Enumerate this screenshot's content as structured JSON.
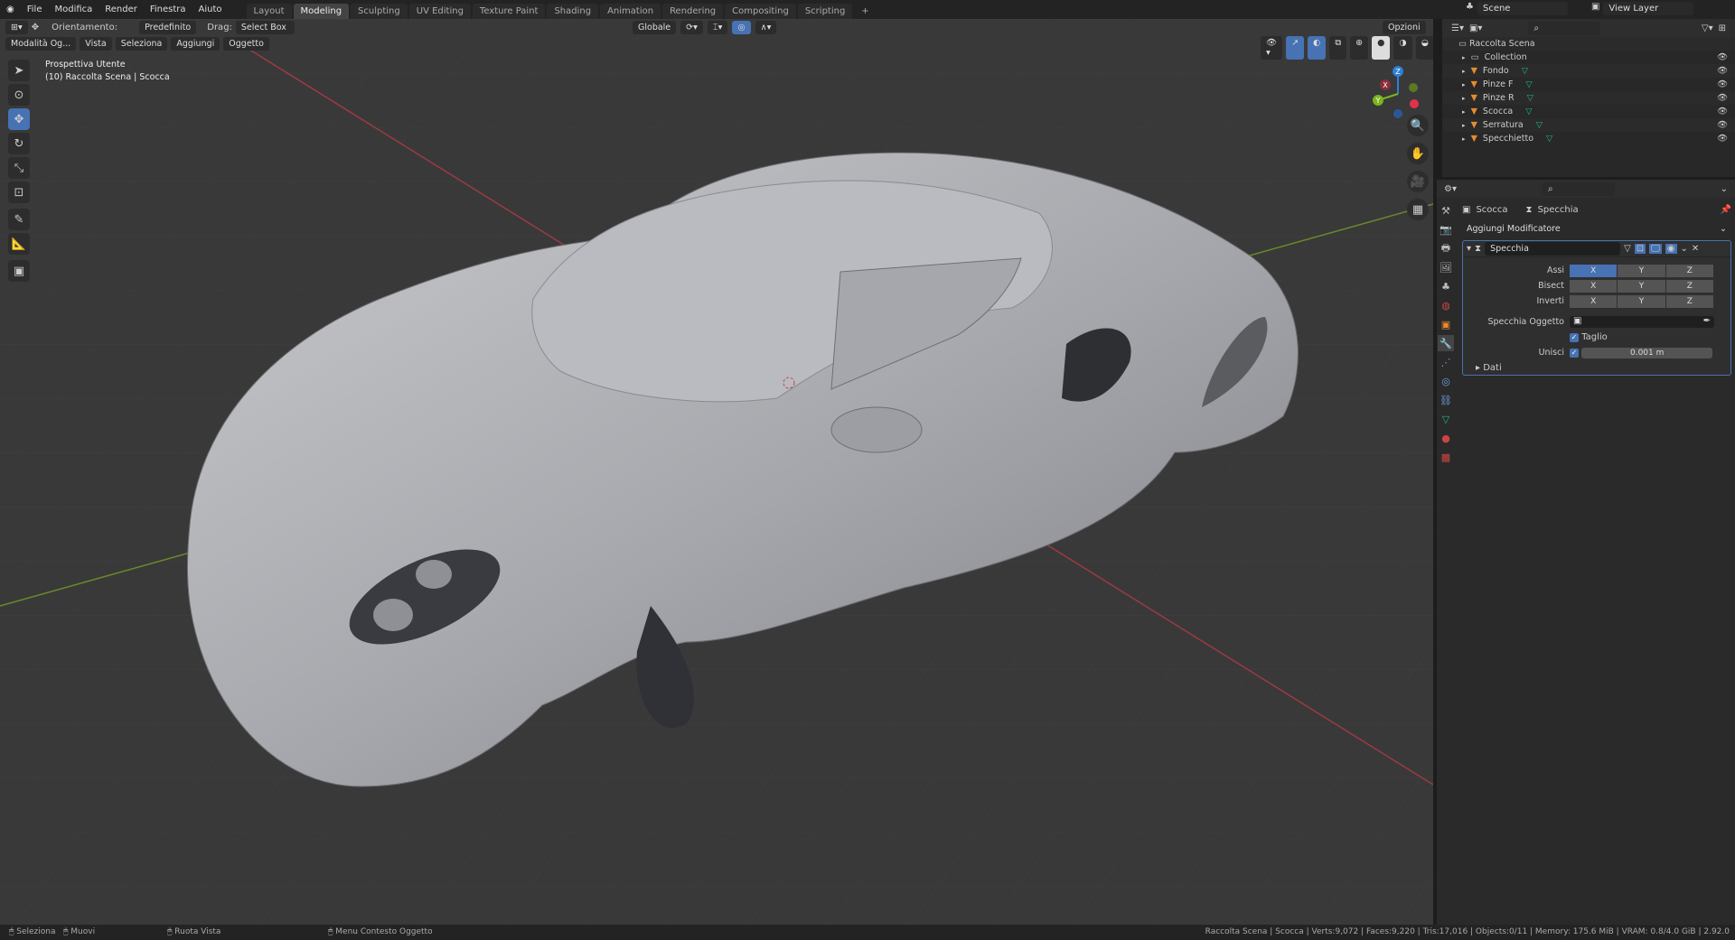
{
  "menu": [
    "File",
    "Modifica",
    "Render",
    "Finestra",
    "Aiuto"
  ],
  "workspaces": [
    "Layout",
    "Modeling",
    "Sculpting",
    "UV Editing",
    "Texture Paint",
    "Shading",
    "Animation",
    "Rendering",
    "Compositing",
    "Scripting",
    "+"
  ],
  "active_workspace": "Modeling",
  "scene": {
    "label": "Scene",
    "view_layer": "View Layer"
  },
  "toolheader": {
    "orient_label": "Orientamento:",
    "orient_value": "Predefinito",
    "drag_label": "Drag:",
    "drag_value": "Select Box",
    "transform": "Globale",
    "options": "Opzioni"
  },
  "viewport_menu": {
    "mode": "Modalità Og...",
    "items": [
      "Vista",
      "Seleziona",
      "Aggiungi",
      "Oggetto"
    ]
  },
  "overlay": {
    "view_name": "Prospettiva Utente",
    "collection": "(10) Raccolta Scena | Scocca"
  },
  "gizmo": {
    "x": "X",
    "y": "Y",
    "z": "Z"
  },
  "outliner": {
    "root": "Raccolta Scena",
    "items": [
      {
        "name": "Collection",
        "icon": "collection-icon"
      },
      {
        "name": "Fondo",
        "icon": "mesh-object-icon"
      },
      {
        "name": "Pinze F",
        "icon": "mesh-object-icon"
      },
      {
        "name": "Pinze R",
        "icon": "mesh-object-icon"
      },
      {
        "name": "Scocca",
        "icon": "mesh-object-icon"
      },
      {
        "name": "Serratura",
        "icon": "mesh-object-icon"
      },
      {
        "name": "Specchietto",
        "icon": "mesh-object-icon"
      }
    ]
  },
  "properties": {
    "breadcrumb_object": "Scocca",
    "breadcrumb_modifier": "Specchia",
    "add_modifier": "Aggiungi Modificatore",
    "modifier_name": "Specchia",
    "rows": [
      {
        "label": "Assi",
        "active": "X"
      },
      {
        "label": "Bisect",
        "active": ""
      },
      {
        "label": "Inverti",
        "active": ""
      }
    ],
    "axes": [
      "X",
      "Y",
      "Z"
    ],
    "mirror_object_label": "Specchia Oggetto",
    "clipping_label": "Taglio",
    "clipping": true,
    "merge_label": "Unisci",
    "merge": true,
    "merge_value": "0.001 m",
    "data_label": "Dati"
  },
  "status": {
    "left": [
      "Seleziona",
      "Muovi",
      "Ruota Vista",
      "Menu Contesto Oggetto"
    ],
    "right": "Raccolta Scena | Scocca | Verts:9,072 | Faces:9,220 | Tris:17,016 | Objects:0/11 | Memory: 175.6 MiB | VRAM: 0.8/4.0 GiB | 2.92.0"
  },
  "colors": {
    "accent": "#4772b3",
    "object": "#e98a2e",
    "mesh": "#1db38b",
    "x_axis": "#c0394b",
    "y_axis": "#7ab51d",
    "z_axis": "#2e7fd9"
  }
}
